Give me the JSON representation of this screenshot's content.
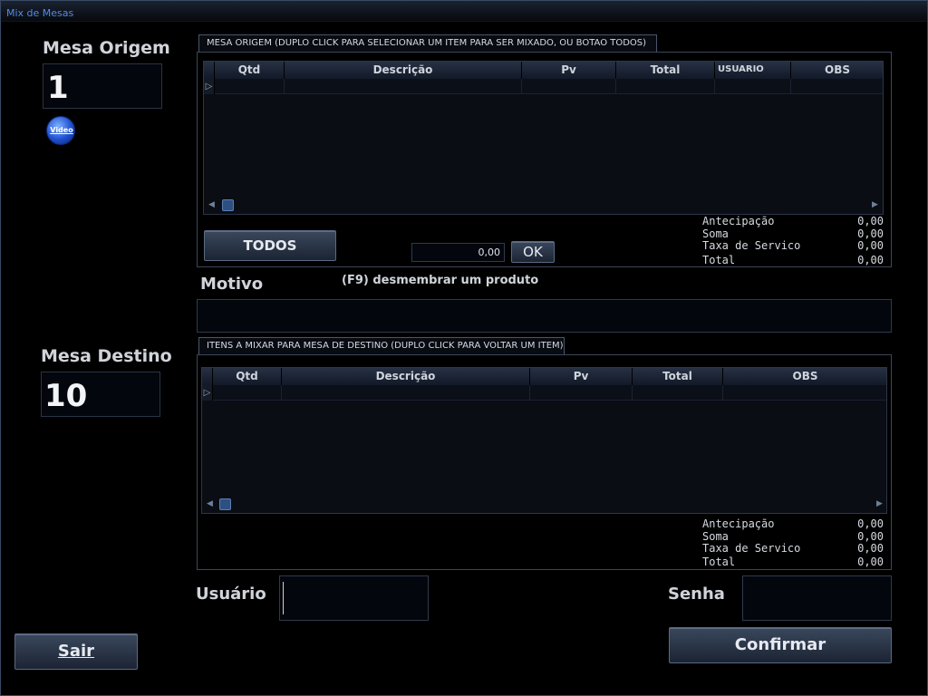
{
  "window": {
    "title": "Mix de Mesas"
  },
  "origem": {
    "label": "Mesa Origem",
    "value": "1",
    "video_label": "Video",
    "tab_title": "MESA ORIGEM   (DUPLO CLICK PARA SELECIONAR UM ITEM PARA SER MIXADO, OU BOTAO TODOS)",
    "columns": [
      "Qtd",
      "Descrição",
      "Pv",
      "Total",
      "USUARIO",
      "OBS"
    ],
    "row_indicator": "▷",
    "todos_button": "TODOS",
    "qty_input": "0,00",
    "ok_button": "OK",
    "totals": {
      "antecipacao_label": "Antecipação",
      "antecipacao_value": "0,00",
      "soma_label": "Soma",
      "soma_value": "0,00",
      "taxa_label": "Taxa de Servico",
      "taxa_value": "0,00",
      "total_label": "Total",
      "total_value": "0,00"
    }
  },
  "motivo": {
    "label": "Motivo",
    "hint": "(F9) desmembrar um produto",
    "value": ""
  },
  "destino": {
    "label": "Mesa Destino",
    "value": "10",
    "tab_title": "ITENS A MIXAR PARA MESA DE DESTINO  (DUPLO CLICK PARA VOLTAR UM ITEM)",
    "columns": [
      "Qtd",
      "Descrição",
      "Pv",
      "Total",
      "OBS"
    ],
    "row_indicator": "▷",
    "totals": {
      "antecipacao_label": "Antecipação",
      "antecipacao_value": "0,00",
      "soma_label": "Soma",
      "soma_value": "0,00",
      "taxa_label": "Taxa de Servico",
      "taxa_value": "0,00",
      "total_label": "Total",
      "total_value": "0,00"
    }
  },
  "login": {
    "usuario_label": "Usuário",
    "usuario_value": "",
    "senha_label": "Senha",
    "senha_value": ""
  },
  "buttons": {
    "sair": "Sair",
    "confirmar": "Confirmar"
  },
  "colors": {
    "title_text": "#4f8be8",
    "background": "#000000",
    "accent": "#2e4f82"
  }
}
